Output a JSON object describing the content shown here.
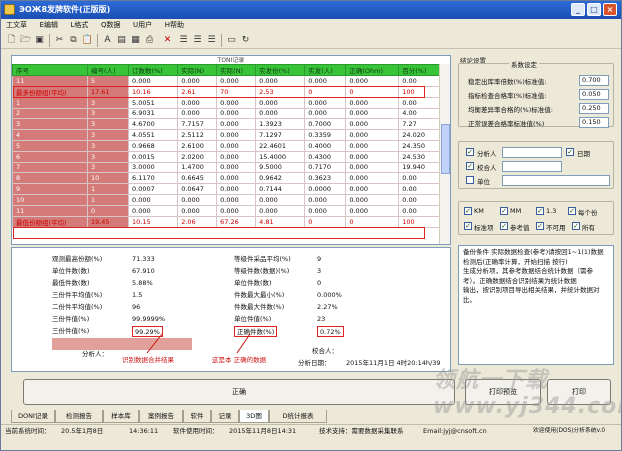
{
  "window": {
    "title": "ЭОЖ8发牌软件(正版版)",
    "min": "_",
    "max": "□",
    "close": "×"
  },
  "menu": [
    "工文草",
    "E编辑",
    "L格式",
    "Q数据",
    "U用户",
    "H帮助"
  ],
  "grid": {
    "caption": "TONI记录",
    "headers": [
      "序号",
      "编号(人)",
      "订数数(%)",
      "实际(N)",
      "实际(N)",
      "实发份(%)",
      "实发(人)",
      "正确(Ohm)",
      "百分(%)"
    ],
    "rows": [
      [
        "11",
        "5",
        "0.000",
        "0.000",
        "0.000",
        "0.000",
        "0.000",
        "0.000",
        "0.00"
      ],
      [
        "最多份额组(平均)",
        "17.61",
        "10.16",
        "2.61",
        "70",
        "2.53",
        "0",
        "0",
        "100"
      ],
      [
        "1",
        "3",
        "5.0051",
        "0.000",
        "0.000",
        "0.000",
        "0.000",
        "0.000",
        "0.00"
      ],
      [
        "2",
        "3",
        "6.9031",
        "0.000",
        "0.000",
        "0.000",
        "0.000",
        "0.000",
        "4.00"
      ],
      [
        "3",
        "3",
        "4.6700",
        "7.7157",
        "0.000",
        "1.3923",
        "0.7000",
        "0.000",
        "7.27"
      ],
      [
        "4",
        "3",
        "4.0551",
        "2.5112",
        "0.000",
        "7.1297",
        "0.3359",
        "0.000",
        "24.020"
      ],
      [
        "5",
        "3",
        "0.9668",
        "2.6100",
        "0.000",
        "22.4601",
        "0.4000",
        "0.000",
        "24.350"
      ],
      [
        "6",
        "3",
        "0.0015",
        "2.0200",
        "0.000",
        "15.4000",
        "0.4300",
        "0.000",
        "24.530"
      ],
      [
        "7",
        "3",
        "3.0000",
        "1.4700",
        "0.000",
        "9.5000",
        "0.7170",
        "0.000",
        "19.940"
      ],
      [
        "8",
        "10",
        "6.1170",
        "0.6645",
        "0.000",
        "0.9642",
        "0.3623",
        "0.000",
        "0.00"
      ],
      [
        "9",
        "1",
        "0.0007",
        "0.0647",
        "0.000",
        "0.7144",
        "0.0000",
        "0.000",
        "0.00"
      ],
      [
        "10",
        "1",
        "0.000",
        "0.000",
        "0.000",
        "0.000",
        "0.000",
        "0.000",
        "0.00"
      ],
      [
        "11",
        "0",
        "0.000",
        "0.000",
        "0.000",
        "0.000",
        "0.000",
        "0.000",
        "0.00"
      ],
      [
        "最低份额组(平均)",
        "19.45",
        "10.15",
        "2.06",
        "67.26",
        "4.81",
        "0",
        "0",
        "100"
      ]
    ]
  },
  "stats": {
    "rows": [
      {
        "l1": "观测最高份额(%)",
        "v1": "71.333",
        "l2": "等级件采品平均(%)",
        "v2": "9"
      },
      {
        "l1": "单位件数(数)",
        "v1": "67.910",
        "l2": "等级件数(数据)(%)",
        "v2": "3"
      },
      {
        "l1": "最低件数(数)",
        "v1": "5.88%",
        "l2": "单位件数(数)",
        "v2": "0"
      },
      {
        "l1": "三份件平均值(%)",
        "v1": "1.5",
        "l2": "件数最大最小(%)",
        "v2": "0.000%"
      },
      {
        "l1": "二份件平均值(%)",
        "v1": "96",
        "l2": "件数最大件数(%)",
        "v2": "2.27%"
      },
      {
        "l1": "三份件值(%)",
        "v1": "99.9999%",
        "l2": "单位件值(%)",
        "v2": "23"
      },
      {
        "l1": "三份件值(%)",
        "v1": "99.29%",
        "l2": "正确件数(%)",
        "v2": "0.72%"
      }
    ],
    "analyst_label": "分析人：",
    "reviewer_label": "校合人：",
    "date_label": "分析日期：",
    "date_value": "2015年11月1日 4时20:14h/39",
    "annotation_left": "识别数据合并结果",
    "annotation_right": "这是本 正确的数据"
  },
  "side": {
    "group1_title": "结论设置",
    "group1_legend": "系数设定",
    "params": [
      {
        "label": "稳定出库率倍数(%)标准值:",
        "value": "0.700"
      },
      {
        "label": "指标检查合格率(%)标准值:",
        "value": "0.050"
      },
      {
        "label": "均衡差异率合格的(%)标准值:",
        "value": "0.250"
      },
      {
        "label": "正常误差合格率标准值(%)",
        "value": "0.150"
      }
    ],
    "chk_analyst": "分析人",
    "chk_date": "日期",
    "chk_reviewer": "校合人",
    "chk_unit": "单位",
    "options": [
      "KM",
      "MM",
      "1.3",
      "每个份"
    ],
    "options2": [
      "标准项",
      "参考值",
      "不可用",
      "所有"
    ],
    "info_text": "备份条件 实际数据检查(参考)请按回1~1(1)数据检测后(正确率计算，开始扫描 按行)\n生成分析项，其参考数据结合统计数据（需参考）。正确数据结合识别结果为统计数据\n输出，按识别项目导出相关结果，并统计数据对比。"
  },
  "buttons": {
    "main": "正确",
    "print_preview": "打印预览",
    "print": "打印"
  },
  "tabs": [
    "DONI记录",
    "检测报告",
    "样本库",
    "案例报告",
    "软件",
    "记录",
    "3D图",
    "D统计报表"
  ],
  "status": {
    "current_date_label": "当前系统时间：",
    "current_date": "20.5年1月8日",
    "time": "14:36:11",
    "sw_label": "软件使用时间：",
    "sw_time": "2015年11月8日14:31",
    "support": "技术支持：需要数据采集联系",
    "email": "Email:jyj@cnsoft.cn",
    "version": "欢迎使用(DOS)分析系统v.0"
  },
  "watermark": "领航一下载 www.yj344.com",
  "colors": {
    "header_green": "#39c339",
    "row_salmon": "#d47a78",
    "highlight_red": "#dd2222",
    "titlebar_blue": "#2c6bd8"
  }
}
